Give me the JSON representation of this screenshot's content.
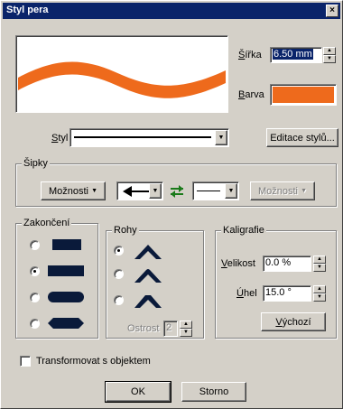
{
  "title": "Styl pera",
  "close_glyph": "×",
  "width": {
    "label_accel": "Š",
    "label_rest": "ířka",
    "value": "6.50 mm"
  },
  "color": {
    "label_accel": "B",
    "label_rest": "arva",
    "value": "#ee6a1c"
  },
  "preview": {
    "stroke_color": "#ee6a1c"
  },
  "style": {
    "label_accel": "S",
    "label_rest": "tyl",
    "edit_button": "Editace stylů..."
  },
  "arrows": {
    "group_label": "Šipky",
    "left_options": "Možnosti",
    "right_options": "Možnosti",
    "swap_icon": "swap-arrows-icon"
  },
  "endings": {
    "group_label": "Zakončení",
    "selected_index": 1
  },
  "corners": {
    "group_label": "Rohy",
    "selected_index": 0,
    "sharpness_label": "Ostrost",
    "sharpness_value": "2"
  },
  "calligraphy": {
    "group_label": "Kaligrafie",
    "size_label_accel": "V",
    "size_label_rest": "elikost",
    "size_value": "0.0 %",
    "angle_label_accel": "Ú",
    "angle_label_rest": "hel",
    "angle_value": "15.0 °",
    "default_button_accel": "V",
    "default_button_rest": "ýchozí"
  },
  "transform": {
    "label": "Transformovat s objektem",
    "checked": false
  },
  "buttons": {
    "ok": "OK",
    "cancel": "Storno"
  }
}
